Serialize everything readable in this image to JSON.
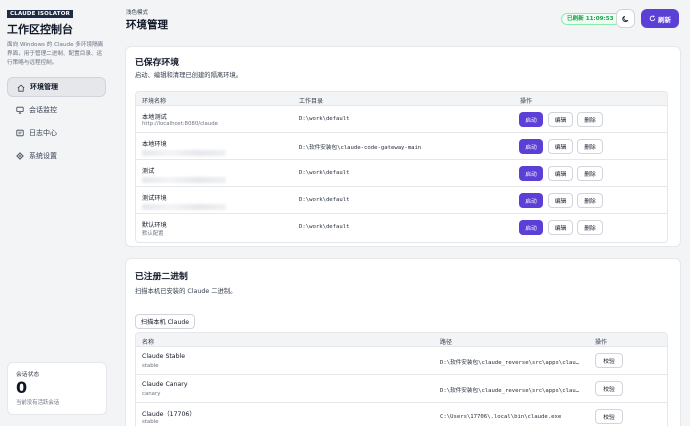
{
  "sidebar": {
    "brand_tag": "CLAUDE ISOLATOR",
    "brand_title": "工作区控制台",
    "brand_desc": "面向 Windows 的 Claude 多环境隔离界面，用于管理二进制、配置目录、运行策略与远程控制。",
    "items": [
      {
        "label": "环境管理",
        "icon": "home-icon",
        "active": true
      },
      {
        "label": "会话监控",
        "icon": "monitor-icon",
        "active": false
      },
      {
        "label": "日志中心",
        "icon": "file-icon",
        "active": false
      },
      {
        "label": "系统设置",
        "icon": "gear-icon",
        "active": false
      }
    ],
    "session": {
      "label": "会话状态",
      "count": "0",
      "sub": "当前没有活跃会话"
    }
  },
  "header": {
    "eyebrow": "浅色模式",
    "title": "环境管理",
    "refresh_status": "已刷新 11:09:53",
    "refresh_label": "刷新"
  },
  "saved": {
    "title": "已保存环境",
    "desc": "启动、编辑和清理已创建的隔离环境。",
    "columns": [
      "环境名称",
      "工作目录",
      "操作"
    ],
    "actions": {
      "start": "启动",
      "edit": "编辑",
      "delete": "删除"
    },
    "rows": [
      {
        "name": "本地测试",
        "sub": "http://localhost:8080/claude",
        "dir": "D:\\work\\default"
      },
      {
        "name": "本地环境",
        "sub": "",
        "dir": "D:\\软件安装包\\claude-code-gateway-main"
      },
      {
        "name": "测试",
        "sub": "",
        "dir": "D:\\work\\default"
      },
      {
        "name": "测试环境",
        "sub": "",
        "dir": "D:\\work\\default"
      },
      {
        "name": "默认环境",
        "sub": "默认配置",
        "dir": "D:\\work\\default"
      }
    ]
  },
  "binaries": {
    "title": "已注册二进制",
    "desc": "扫描本机已安装的 Claude 二进制。",
    "scan_label": "扫描本机 Claude",
    "columns": [
      "名称",
      "路径",
      "操作"
    ],
    "verify_label": "校验",
    "rows": [
      {
        "name": "Claude Stable",
        "channel": "stable",
        "path": "D:\\软件安装包\\claude_reverse\\src\\apps\\clau…"
      },
      {
        "name": "Claude Canary",
        "channel": "canary",
        "path": "D:\\软件安装包\\claude_reverse\\src\\apps\\clau…"
      },
      {
        "name": "Claude（17706）",
        "channel": "stable",
        "path": "C:\\Users\\17706\\.local\\bin\\claude.exe"
      }
    ]
  },
  "colors": {
    "accent": "#5b3fd6",
    "success": "#16a34a"
  }
}
